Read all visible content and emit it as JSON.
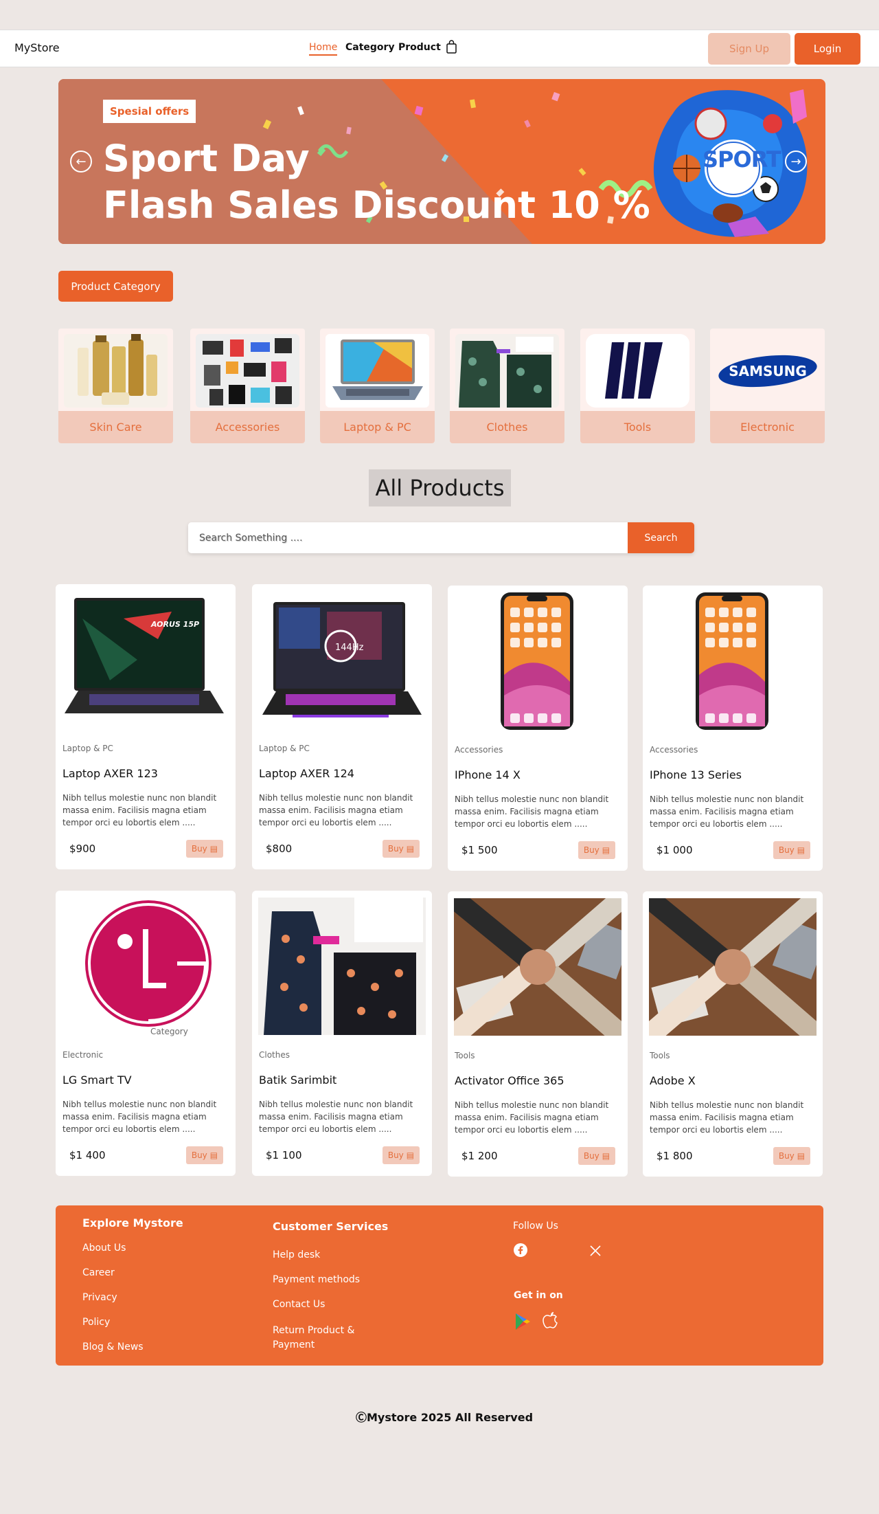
{
  "nav": {
    "brand": "MyStore",
    "links": [
      "Home",
      "Category",
      "Product"
    ],
    "signup": "Sign Up",
    "login": "Login"
  },
  "hero": {
    "badge": "Spesial offers",
    "line1": "Sport Day",
    "line2": "Flash Sales Discount 10 %",
    "sport_logo": "SPORT"
  },
  "categories": {
    "button": "Product Category",
    "items": [
      "Skin Care",
      "Accessories",
      "Laptop & PC",
      "Clothes",
      "Tools",
      "Electronic"
    ]
  },
  "products_section": {
    "title": "All Products",
    "search_placeholder": "Search Something ....",
    "search_button": "Search"
  },
  "products": [
    {
      "category": "Laptop & PC",
      "name": "Laptop AXER 123",
      "description": "Nibh tellus molestie nunc non blandit massa enim. Facilisis magna etiam tempor orci eu lobortis elem .....",
      "price": "$900",
      "buy": "Buy"
    },
    {
      "category": "Laptop & PC",
      "name": "Laptop AXER 124",
      "description": "Nibh tellus molestie nunc non blandit massa enim. Facilisis magna etiam tempor orci eu lobortis elem .....",
      "price": "$800",
      "buy": "Buy"
    },
    {
      "category": "Accessories",
      "name": "IPhone 14 X",
      "description": "Nibh tellus molestie nunc non blandit massa enim. Facilisis magna etiam tempor orci eu lobortis elem .....",
      "price": "$1 500",
      "buy": "Buy"
    },
    {
      "category": "Accessories",
      "name": "IPhone 13 Series",
      "description": "Nibh tellus molestie nunc non blandit massa enim. Facilisis magna etiam tempor orci eu lobortis elem .....",
      "price": "$1 000",
      "buy": "Buy"
    },
    {
      "category": "Electronic",
      "name": "LG Smart TV",
      "description": "Nibh tellus molestie nunc non blandit massa enim. Facilisis magna etiam tempor orci eu lobortis elem .....",
      "price": "$1 400",
      "buy": "Buy",
      "image_caption": "Category"
    },
    {
      "category": "Clothes",
      "name": "Batik Sarimbit",
      "description": "Nibh tellus molestie nunc non blandit massa enim. Facilisis magna etiam tempor orci eu lobortis elem .....",
      "price": "$1 100",
      "buy": "Buy"
    },
    {
      "category": "Tools",
      "name": "Activator Office 365",
      "description": "Nibh tellus molestie nunc non blandit massa enim. Facilisis magna etiam tempor orci eu lobortis elem .....",
      "price": "$1 200",
      "buy": "Buy"
    },
    {
      "category": "Tools",
      "name": "Adobe X",
      "description": "Nibh tellus molestie nunc non blandit massa enim. Facilisis magna etiam tempor orci eu lobortis elem .....",
      "price": "$1 800",
      "buy": "Buy"
    }
  ],
  "footer": {
    "explore": {
      "title": "Explore Mystore",
      "links": [
        "About Us",
        "Career",
        "Privacy",
        "Policy",
        "Blog & News"
      ]
    },
    "services": {
      "title": "Customer Services",
      "links": [
        "Help desk",
        "Payment methods",
        "Contact Us",
        "Return  Product & Payment"
      ]
    },
    "follow": "Follow  Us",
    "getin": "Get in on",
    "copyright": "ⒸMystore  2025    All Reserved"
  },
  "colors": {
    "accent": "#e9612a",
    "accent_light": "#f2c9ba",
    "background": "#ede7e4"
  }
}
